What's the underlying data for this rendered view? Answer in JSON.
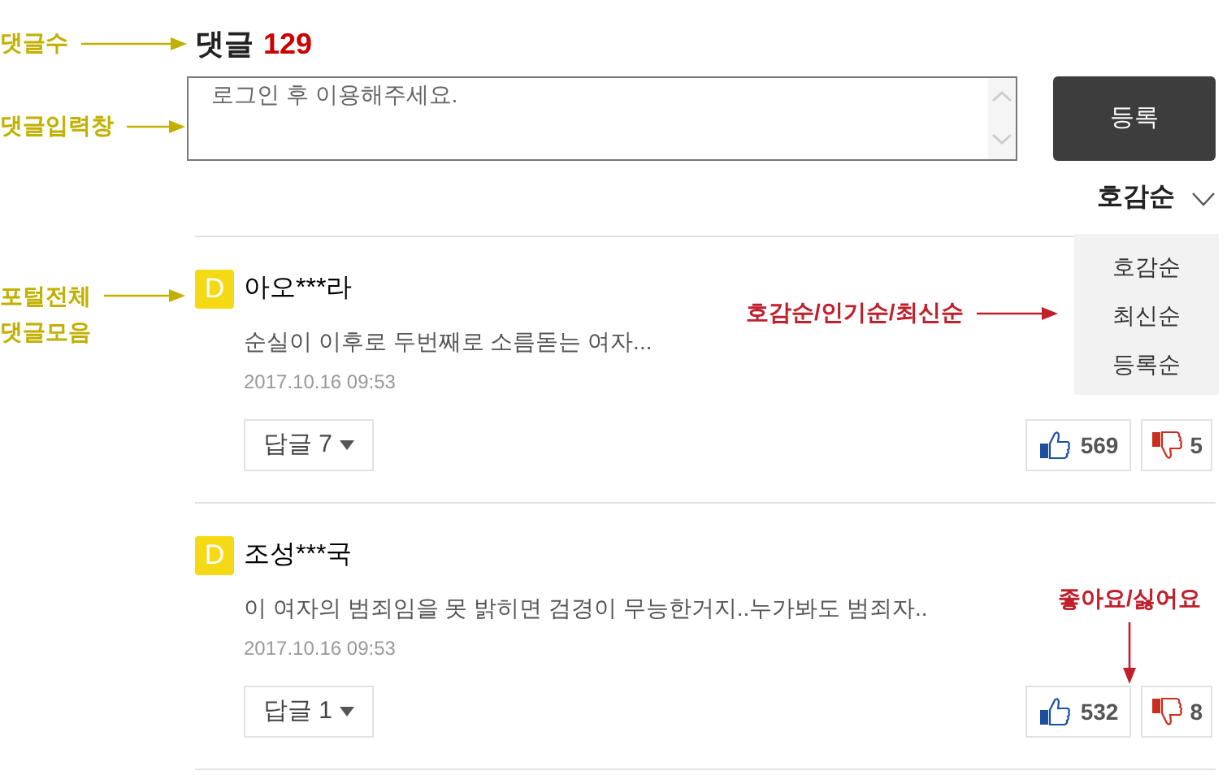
{
  "comment_count": {
    "label": "댓글",
    "count": "129"
  },
  "comment_input": {
    "placeholder": "로그인 후 이용해주세요."
  },
  "submit_button": "등록",
  "sort": {
    "current": "호감순",
    "expanded": true,
    "options": [
      "호감순",
      "최신순",
      "등록순"
    ]
  },
  "comments": [
    {
      "avatar": "D",
      "author": "아오***라",
      "text": "순실이 이후로 두번째로 소름돋는 여자...",
      "date": "2017.10.16 09:53",
      "replies": "답글 7",
      "likes": "569",
      "dislikes": "5"
    },
    {
      "avatar": "D",
      "author": "조성***국",
      "text": "이 여자의 범죄임을 못 밝히면 검경이 무능한거지..누가봐도 범죄자..",
      "date": "2017.10.16 09:53",
      "replies": "답글 1",
      "likes": "532",
      "dislikes": "8"
    }
  ],
  "annotations": {
    "comment_count": "댓글수",
    "comment_input": "댓글입력창",
    "portal_comments": [
      "포털전체",
      "댓글모음"
    ],
    "sort_options": "호감순/인기순/최신순",
    "reactions": "좋아요/싫어요"
  }
}
